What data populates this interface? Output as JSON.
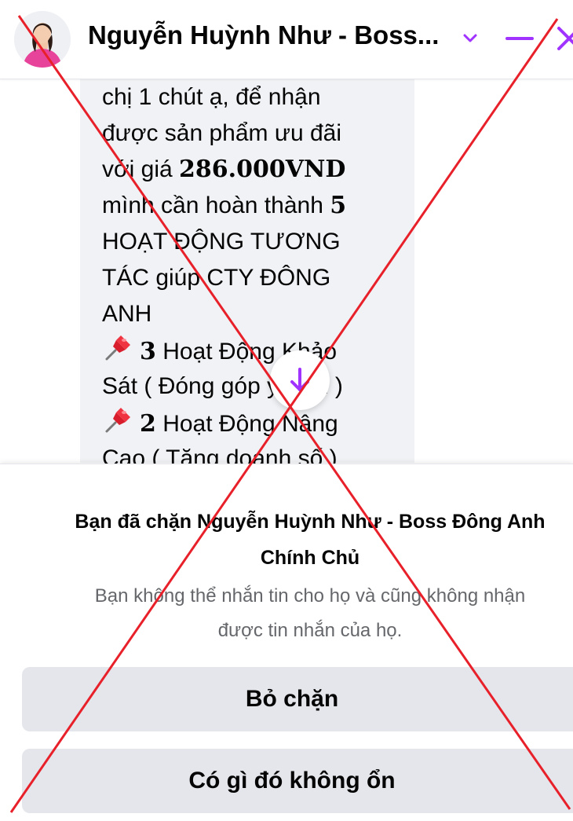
{
  "header": {
    "contact_name": "Nguyễn Huỳnh Như - Boss...",
    "avatar_icon": "person-avatar",
    "icons": [
      "chevron-down-icon",
      "minimize-icon",
      "close-icon"
    ],
    "accent_color": "#a033ff"
  },
  "message": {
    "line1": "chị 1 chút ạ, để nhận",
    "line2": "được sản phẩm ưu đãi",
    "line3_prefix": "với giá ",
    "price": "286.000VND",
    "line4_prefix": "mình cần hoàn thành ",
    "count_total": "5",
    "line5": "HOẠT ĐỘNG TƯƠNG",
    "line6": "TÁC giúp CTY ĐÔNG",
    "line7": "ANH",
    "item1_count": "3",
    "item1_text": " Hoạt Động Khảo",
    "item1_text2": "Sát ( Đóng góp ý kiến )",
    "item2_count": "2",
    "item2_text": " Hoạt Động Nâng",
    "item2_text2": "Cao ( Tăng doanh số )",
    "pin_icon": "pushpin-icon"
  },
  "blocked": {
    "title_line1": "Bạn đã chặn Nguyễn Huỳnh Như - Boss Đông Anh",
    "title_line2": "Chính Chủ",
    "desc_line1": "Bạn không thể nhắn tin cho họ và cũng không nhận",
    "desc_line2": "được tin nhắn của họ.",
    "unblock_label": "Bỏ chặn",
    "report_label": "Có gì đó không ổn"
  },
  "overlay": {
    "mark": "red-x-cross",
    "color": "#e8202a"
  }
}
